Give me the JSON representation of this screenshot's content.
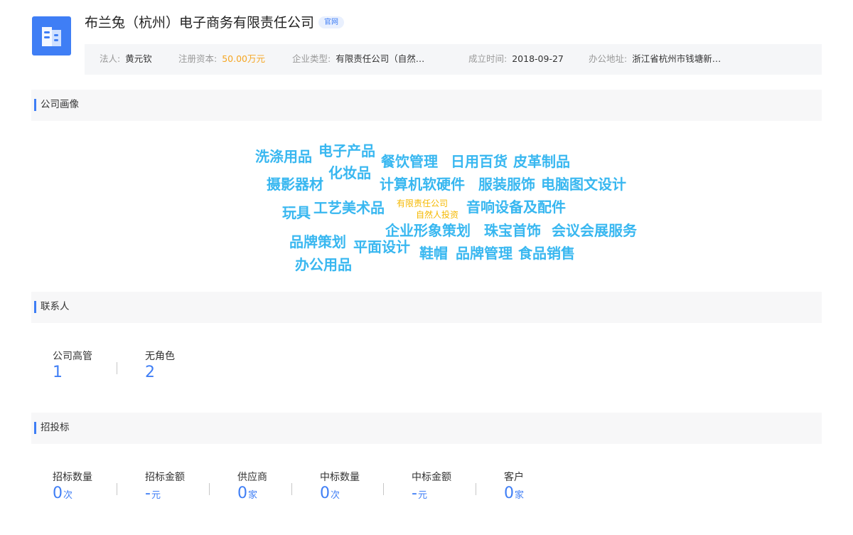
{
  "header": {
    "logo_icon": "building-icon",
    "company_name": "布兰兔（杭州）电子商务有限责任公司",
    "official_tag": "官网"
  },
  "info": {
    "legal_rep_label": "法人:",
    "legal_rep": "黄元钦",
    "capital_label": "注册资本:",
    "capital": "50.00万元",
    "type_label": "企业类型:",
    "type": "有限责任公司（自然…",
    "founded_label": "成立时间:",
    "founded": "2018-09-27",
    "address_label": "办公地址:",
    "address": "浙江省杭州市钱塘新…"
  },
  "portrait": {
    "title": "公司画像",
    "words": [
      "洗涤用品",
      "电子产品",
      "餐饮管理",
      "日用百货",
      "皮革制品",
      "化妆品",
      "摄影器材",
      "计算机软硬件",
      "服装服饰",
      "电脑图文设计",
      "玩具",
      "工艺美术品",
      "有限责任公司",
      "自然人投资",
      "音响设备及配件",
      "企业形象策划",
      "珠宝首饰",
      "会议会展服务",
      "品牌策划",
      "平面设计",
      "鞋帽",
      "品牌管理",
      "食品销售",
      "办公用品"
    ]
  },
  "contacts": {
    "title": "联系人",
    "stats": [
      {
        "label": "公司高管",
        "value": "1"
      },
      {
        "label": "无角色",
        "value": "2"
      }
    ]
  },
  "bidding": {
    "title": "招投标",
    "stats": [
      {
        "label": "招标数量",
        "value": "0",
        "unit": "次"
      },
      {
        "label": "招标金额",
        "value": "-",
        "unit": "元"
      },
      {
        "label": "供应商",
        "value": "0",
        "unit": "家"
      },
      {
        "label": "中标数量",
        "value": "0",
        "unit": "次"
      },
      {
        "label": "中标金额",
        "value": "-",
        "unit": "元"
      },
      {
        "label": "客户",
        "value": "0",
        "unit": "家"
      }
    ]
  },
  "colors": {
    "accent": "#3f7ef5",
    "cloud_word": "#38b7f0",
    "cloud_small": "#f5b800",
    "capital": "#f5a623"
  }
}
